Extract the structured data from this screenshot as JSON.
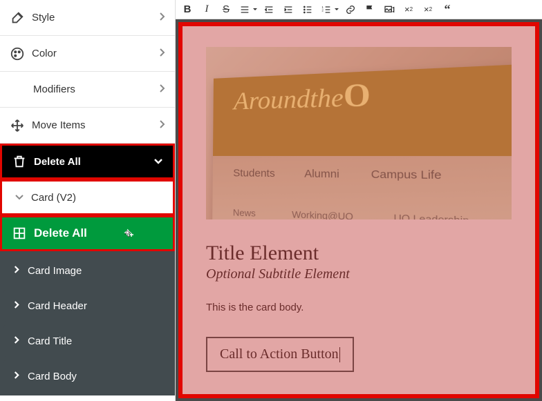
{
  "sidebar": {
    "style": "Style",
    "color": "Color",
    "modifiers": "Modifiers",
    "move_items": "Move Items",
    "delete_all_1": "Delete All",
    "card_v2": "Card (V2)",
    "delete_all_2": "Delete All",
    "items": [
      "Card Image",
      "Card Header",
      "Card Title",
      "Card Body"
    ]
  },
  "toolbar": {
    "bold": "B",
    "italic": "I",
    "strike": "S"
  },
  "preview": {
    "banner_prefix": "Aroundthe",
    "banner_O": "O",
    "menu_row1": [
      "Students",
      "Alumni",
      "Campus Life"
    ],
    "menu_row2": [
      "News",
      "Working@UO",
      "UO Leadership"
    ],
    "title": "Title Element",
    "subtitle": "Optional Subtitle Element",
    "body": "This is the card body.",
    "cta": "Call to Action Button"
  }
}
